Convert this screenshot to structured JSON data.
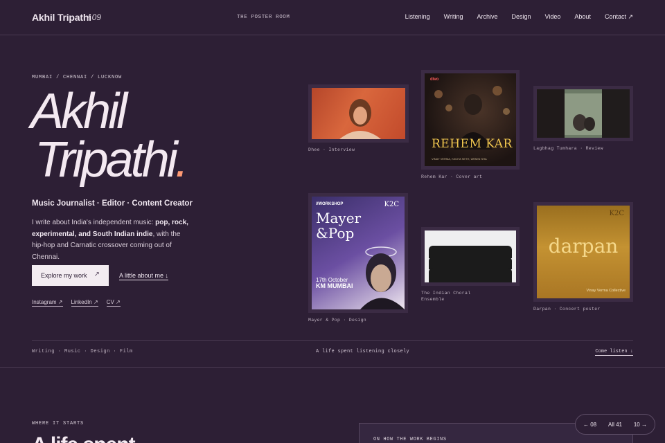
{
  "header": {
    "brand": "Akhil Tripathi",
    "brand_number": "/ 09",
    "section_title": "THE POSTER ROOM",
    "nav": [
      "Listening",
      "Writing",
      "Archive",
      "Design",
      "Video",
      "About",
      "Contact ↗"
    ]
  },
  "hero": {
    "location": "MUMBAI / CHENNAI / LUCKNOW",
    "name_line1": "Akhil",
    "name_line2": "Tripathi",
    "name_dot": ".",
    "role": "Music Journalist · Editor · Content Creator",
    "bio_prefix": "I write about India's independent music: ",
    "bio_bold": "pop, rock, experimental, and South Indian indie",
    "bio_suffix": ", with the hip-hop and Carnatic crossover coming out of Chennai.",
    "primary_button": "Explore my work",
    "primary_button_arrow": "↗",
    "secondary_link": "A little about me ↓",
    "socials": [
      "Instagram ↗",
      "LinkedIn ↗",
      "CV ↗"
    ]
  },
  "posters": [
    {
      "caption": "Dhee · Interview"
    },
    {
      "caption": "Rehem Kar · Cover art",
      "title": "REHEM KAR",
      "subtitle": "VINAY VERMA, KAVITA SETH, WEMIN SHA",
      "logo": "divo"
    },
    {
      "caption": "Lagbhag Tumhara · Review"
    },
    {
      "caption": "Mayer & Pop · Design",
      "tag": "//WORKSHOP",
      "title_line1": "Mayer",
      "title_line2": "&Pop",
      "date": "17th October",
      "place": "KM MUMBAI",
      "logo": "K2C"
    },
    {
      "caption": "The Indian Choral Ensemble"
    },
    {
      "caption": "Darpan · Concert poster",
      "title": "darpan",
      "credit": "Vinay Verma Collective",
      "logo": "K2C"
    }
  ],
  "strip": {
    "categories": "Writing · Music · Design · Film",
    "tagline": "A life spent listening closely",
    "cta": "Come listen ↓"
  },
  "next_section": {
    "eyebrow": "WHERE IT STARTS",
    "heading_partial": "A life spent",
    "panel_label": "ON HOW THE WORK BEGINS"
  },
  "pager": {
    "prev": "← 08",
    "all": "All 41",
    "next": "10 →"
  }
}
